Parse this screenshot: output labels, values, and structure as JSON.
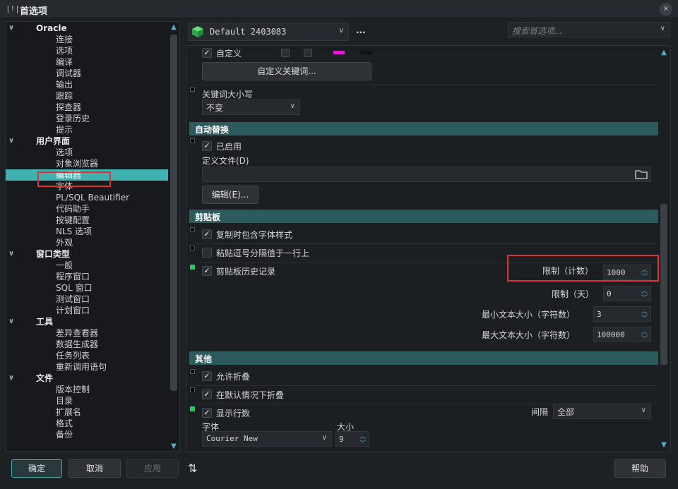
{
  "window": {
    "title": "首选项",
    "title_icon": "|!|",
    "close": "×"
  },
  "tree": [
    {
      "label": "Oracle",
      "type": "cat",
      "arrow": "∨"
    },
    {
      "label": "连接",
      "type": "leaf"
    },
    {
      "label": "选项",
      "type": "leaf"
    },
    {
      "label": "编译",
      "type": "leaf"
    },
    {
      "label": "调试器",
      "type": "leaf"
    },
    {
      "label": "输出",
      "type": "leaf"
    },
    {
      "label": "跟踪",
      "type": "leaf"
    },
    {
      "label": "探查器",
      "type": "leaf"
    },
    {
      "label": "登录历史",
      "type": "leaf"
    },
    {
      "label": "提示",
      "type": "leaf"
    },
    {
      "label": "用户界面",
      "type": "cat",
      "arrow": "∨"
    },
    {
      "label": "选项",
      "type": "leaf"
    },
    {
      "label": "对象浏览器",
      "type": "leaf"
    },
    {
      "label": "编辑器",
      "type": "leaf",
      "selected": true
    },
    {
      "label": "字体",
      "type": "leaf"
    },
    {
      "label": "PL/SQL Beautifier",
      "type": "leaf"
    },
    {
      "label": "代码助手",
      "type": "leaf"
    },
    {
      "label": "按键配置",
      "type": "leaf"
    },
    {
      "label": "NLS 选项",
      "type": "leaf"
    },
    {
      "label": "外观",
      "type": "leaf"
    },
    {
      "label": "窗口类型",
      "type": "cat",
      "arrow": "∨"
    },
    {
      "label": "一般",
      "type": "leaf"
    },
    {
      "label": "程序窗口",
      "type": "leaf"
    },
    {
      "label": "SQL 窗口",
      "type": "leaf"
    },
    {
      "label": "测试窗口",
      "type": "leaf"
    },
    {
      "label": "计划窗口",
      "type": "leaf"
    },
    {
      "label": "工具",
      "type": "cat",
      "arrow": "∨"
    },
    {
      "label": "差异查看器",
      "type": "leaf"
    },
    {
      "label": "数据生成器",
      "type": "leaf"
    },
    {
      "label": "任务列表",
      "type": "leaf"
    },
    {
      "label": "重新调用语句",
      "type": "leaf"
    },
    {
      "label": "文件",
      "type": "cat",
      "arrow": "∨"
    },
    {
      "label": "版本控制",
      "type": "leaf"
    },
    {
      "label": "目录",
      "type": "leaf"
    },
    {
      "label": "扩展名",
      "type": "leaf"
    },
    {
      "label": "格式",
      "type": "leaf"
    },
    {
      "label": "备份",
      "type": "leaf"
    }
  ],
  "profile": {
    "value": "Default 2403083",
    "more": "..."
  },
  "search": {
    "placeholder": "搜索首选项..."
  },
  "panel": {
    "custom": {
      "label": "自定义",
      "button": "自定义关键词..."
    },
    "keyword_case": {
      "label": "关键词大小写",
      "value": "不变"
    },
    "auto_replace": {
      "header": "自动替换",
      "enabled": "已启用",
      "def_file": "定义文件(D)",
      "edit": "编辑(E)..."
    },
    "clipboard": {
      "header": "剪贴板",
      "copy_font": "复制时包含字体样式",
      "paste_comma": "粘贴逗号分隔值于一行上",
      "history": "剪贴板历史记录",
      "limit_count_label": "限制（计数）",
      "limit_count_value": "1000",
      "limit_days_label": "限制（天）",
      "limit_days_value": "0",
      "min_size_label": "最小文本大小（字符数）",
      "min_size_value": "3",
      "max_size_label": "最大文本大小（字符数）",
      "max_size_value": "100000"
    },
    "other": {
      "header": "其他",
      "allow_fold": "允许折叠",
      "fold_default": "在默认情况下折叠",
      "show_lines": "显示行数",
      "interval_label": "间隔",
      "interval_value": "全部",
      "font_label": "字体",
      "font_value": "Courier New",
      "size_label": "大小",
      "size_value": "9"
    }
  },
  "footer": {
    "ok": "确定",
    "cancel": "取消",
    "apply": "应用",
    "help": "帮助"
  },
  "colors": {
    "accent": "#3fb1b0",
    "section": "#2c5b5d",
    "highlight": "#e03232",
    "magenta": "#e21ad6"
  }
}
